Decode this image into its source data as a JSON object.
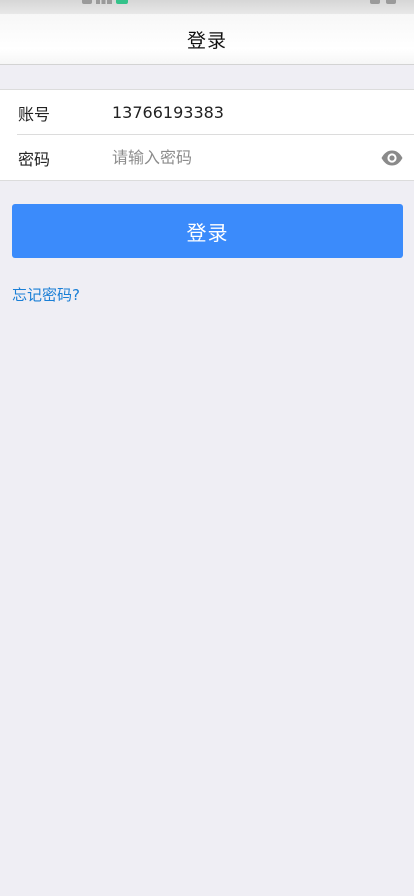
{
  "nav": {
    "title": "登录"
  },
  "form": {
    "account_label": "账号",
    "account_value": "13766193383",
    "password_label": "密码",
    "password_placeholder": "请输入密码",
    "password_toggle_icon": "eye-icon"
  },
  "actions": {
    "login_label": "登录",
    "forgot_label": "忘记密码?"
  },
  "colors": {
    "primary": "#3b8bfb",
    "link": "#1a7fd6",
    "background": "#efeef4"
  }
}
